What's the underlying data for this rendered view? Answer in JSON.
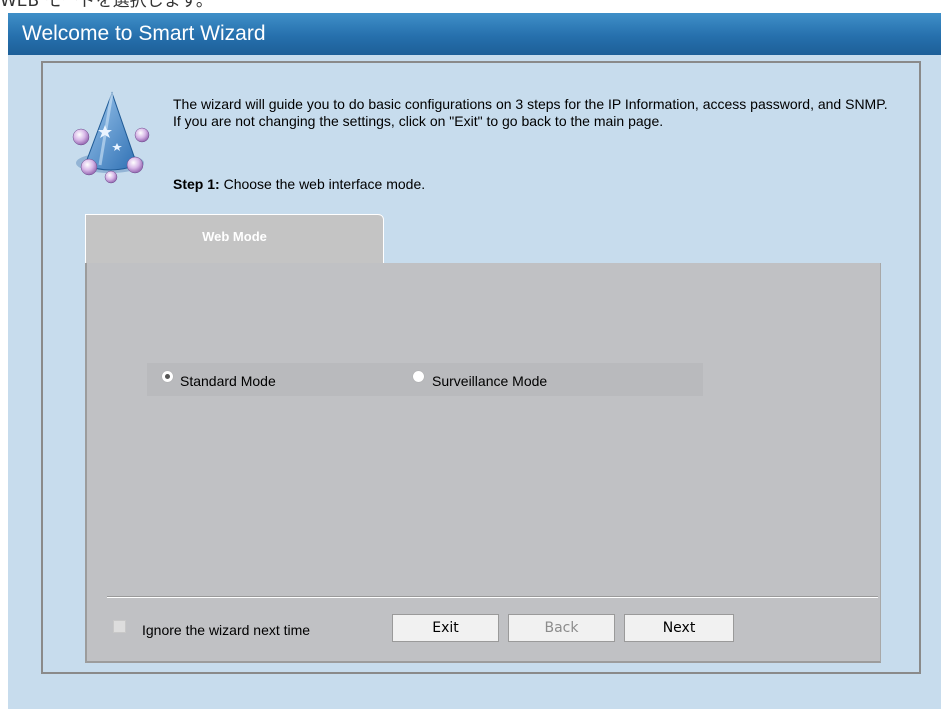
{
  "page": {
    "top_text": "WEB モードを選択します。"
  },
  "dialog": {
    "title": "Welcome to Smart Wizard",
    "icon": "wizard-hat-icon",
    "intro": "The wizard will guide you to do basic configurations on 3 steps for the IP Information, access password, and SNMP. If you are not changing the settings, click on \"Exit\" to go back to the main page.",
    "step_prefix": "Step 1:",
    "step_text": " Choose the web interface mode."
  },
  "tab": {
    "label": "Web Mode"
  },
  "modes": [
    {
      "label": "Standard Mode",
      "selected": true
    },
    {
      "label": "Surveillance Mode",
      "selected": false
    }
  ],
  "footer": {
    "ignore_label": "Ignore the wizard next time",
    "ignore_checked": false,
    "exit_label": "Exit",
    "back_label": "Back",
    "back_disabled": true,
    "next_label": "Next"
  },
  "colors": {
    "title_bar": "#2670ad",
    "dialog_bg": "#c7dced",
    "panel_bg": "#c0c1c4"
  }
}
